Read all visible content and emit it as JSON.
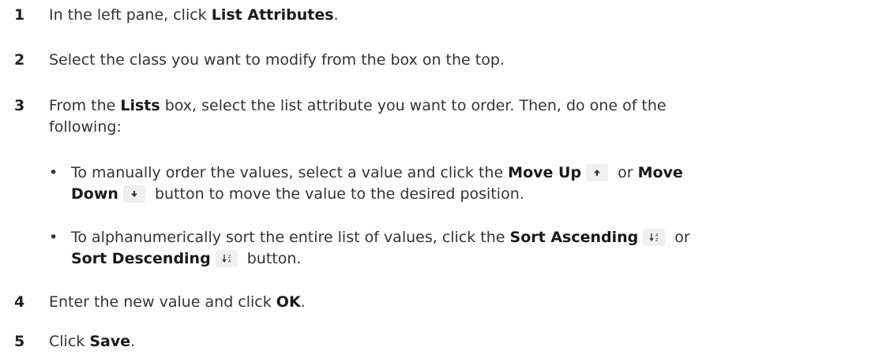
{
  "steps": [
    {
      "num": "1",
      "t1": "In the left pane, click ",
      "b1": "List Attributes",
      "t2": "."
    },
    {
      "num": "2",
      "t1": "Select the class you want to modify from the box on the top."
    },
    {
      "num": "3",
      "t1": "From the ",
      "b1": "Lists",
      "line1_rest": " box, select the list attribute you want to order. Then, do one of the",
      "line2": "following:"
    },
    {
      "num": "4",
      "t1": "Enter the new value and click ",
      "b1": "OK",
      "t2": "."
    },
    {
      "num": "5",
      "t1": "Click ",
      "b1": "Save",
      "t2": "."
    }
  ],
  "bullets": [
    {
      "dot": "•",
      "t1": "To manually order the values, select a value and click the ",
      "b1": "Move Up",
      "t2": " or ",
      "b2": "Move",
      "b3": "Down",
      "t3": " button to move the value to the desired position.",
      "icon1": "arrow-up-icon",
      "icon2": "arrow-down-icon"
    },
    {
      "dot": "•",
      "t1": "To alphanumerically sort the entire list of values, click the ",
      "b1": "Sort Ascending",
      "t2": " or",
      "b2": "Sort Descending",
      "t3": " button.",
      "icon1": "sort-ascending-icon",
      "icon2": "sort-descending-icon"
    }
  ],
  "colors": {
    "text": "#333333",
    "icon_bg": "#f0f0f0"
  }
}
